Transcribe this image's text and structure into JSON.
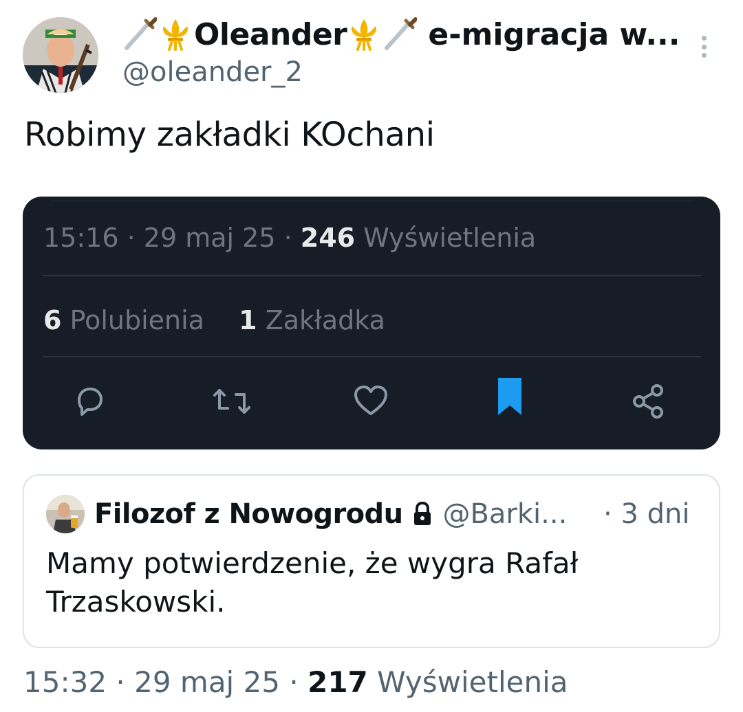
{
  "author": {
    "display_name": "Oleander",
    "name_suffix": "e-migracja w...",
    "handle": "@oleander_2",
    "icons": [
      "dagger-icon",
      "fleur-de-lis-icon",
      "fleur-de-lis-icon",
      "dagger-icon"
    ]
  },
  "tweet": {
    "text": "Robimy zakładki KOchani"
  },
  "embedded_screenshot": {
    "time": "15:16",
    "date": "29 maj 25",
    "views_count": "246",
    "views_label": "Wyświetlenia",
    "likes_count": "6",
    "likes_label": "Polubienia",
    "bookmarks_count": "1",
    "bookmarks_label": "Zakładka",
    "colors": {
      "background": "#161d27",
      "bookmark_active": "#1d9bf0"
    }
  },
  "quoted_tweet": {
    "display_name": "Filozof z Nowogrodu",
    "handle": "@Barki...",
    "time_ago": "3 dni",
    "text": "Mamy potwierdzenie, że wygra Rafał Trzaskowski."
  },
  "meta": {
    "time": "15:32",
    "date": "29 maj 25",
    "views_count": "217",
    "views_label": "Wyświetlenia"
  }
}
